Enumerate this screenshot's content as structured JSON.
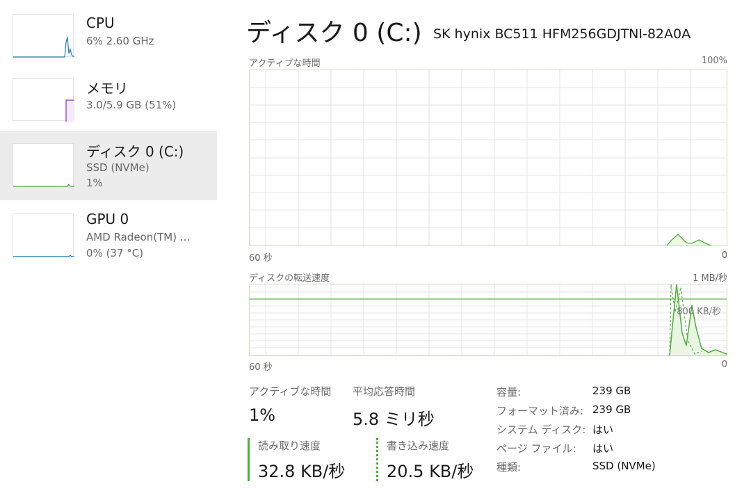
{
  "sidebar": {
    "items": [
      {
        "title": "CPU",
        "line1": "6%  2.60 GHz",
        "line2": ""
      },
      {
        "title": "メモリ",
        "line1": "3.0/5.9 GB (51%)",
        "line2": ""
      },
      {
        "title": "ディスク 0 (C:)",
        "line1": "SSD (NVMe)",
        "line2": "1%"
      },
      {
        "title": "GPU 0",
        "line1": "AMD Radeon(TM) ...",
        "line2": "0%  (37 °C)"
      }
    ]
  },
  "header": {
    "title": "ディスク 0 (C:)",
    "model": "SK hynix BC511 HFM256GDJTNI-82A0A"
  },
  "active_graph": {
    "label": "アクティブな時間",
    "max_label": "100%",
    "left_label": "60 秒",
    "right_label": "0"
  },
  "transfer_graph": {
    "label": "ディスクの転送速度",
    "max_label": "1 MB/秒",
    "mid_label": "800 KB/秒",
    "left_label": "60 秒",
    "right_label": "0"
  },
  "stats": {
    "active_time_label": "アクティブな時間",
    "active_time_value": "1%",
    "avg_response_label": "平均応答時間",
    "avg_response_value": "5.8 ミリ秒",
    "read_speed_label": "読み取り速度",
    "read_speed_value": "32.8 KB/秒",
    "write_speed_label": "書き込み速度",
    "write_speed_value": "20.5 KB/秒"
  },
  "properties": [
    {
      "label": "容量:",
      "value": "239 GB"
    },
    {
      "label": "フォーマット済み:",
      "value": "239 GB"
    },
    {
      "label": "システム ディスク:",
      "value": "はい"
    },
    {
      "label": "ページ ファイル:",
      "value": "はい"
    },
    {
      "label": "種類:",
      "value": "SSD (NVMe)"
    }
  ],
  "colors": {
    "cpu": "#1c7fb5",
    "memory": "#8b2fc9",
    "disk": "#4caf3a",
    "gpu": "#1c7fb5",
    "grid": "#e6e6e6",
    "selected_bg": "#ececec"
  }
}
